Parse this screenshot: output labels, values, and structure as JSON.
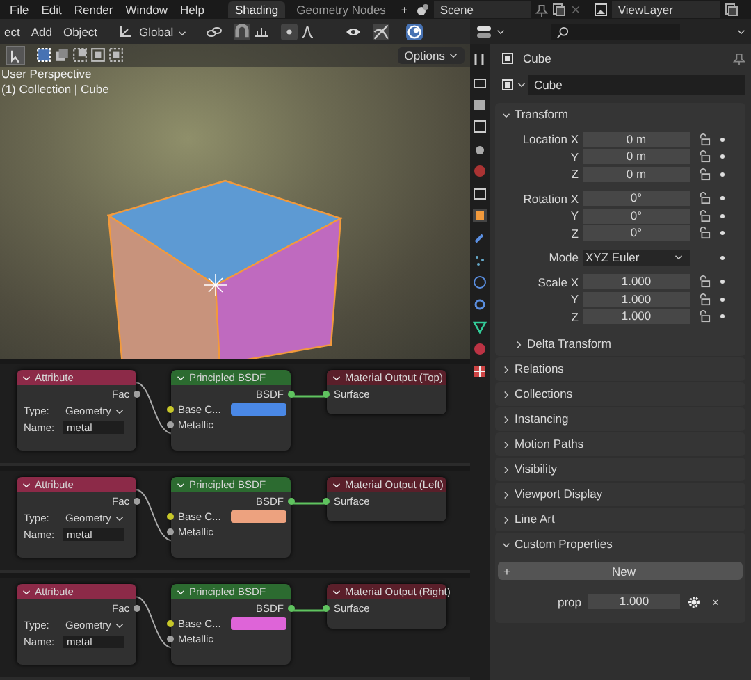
{
  "menu": [
    "File",
    "Edit",
    "Render",
    "Window",
    "Help"
  ],
  "workspace_tabs": [
    {
      "label": "Shading",
      "selected": true
    },
    {
      "label": "Geometry Nodes",
      "selected": false
    }
  ],
  "add_tab": "+",
  "scene": "Scene",
  "view_layer": "ViewLayer",
  "viewport_header": {
    "menus": [
      "ect",
      "Add",
      "Object"
    ],
    "orientation": "Global"
  },
  "viewport": {
    "options": "Options",
    "title": "User Perspective",
    "subtitle": "(1) Collection | Cube"
  },
  "node_editors": [
    {
      "attribute": {
        "title": "Attribute",
        "fac": "Fac",
        "type_label": "Type:",
        "type_value": "Geometry",
        "name_label": "Name:",
        "name_value": "metal"
      },
      "bsdf": {
        "title": "Principled BSDF",
        "output": "BSDF",
        "base_color": "Base C...",
        "metallic": "Metallic",
        "color": "#4a88e6"
      },
      "output": {
        "title": "Material Output (Top)",
        "surface": "Surface"
      }
    },
    {
      "attribute": {
        "title": "Attribute",
        "fac": "Fac",
        "type_label": "Type:",
        "type_value": "Geometry",
        "name_label": "Name:",
        "name_value": "metal"
      },
      "bsdf": {
        "title": "Principled BSDF",
        "output": "BSDF",
        "base_color": "Base C...",
        "metallic": "Metallic",
        "color": "#eda27f"
      },
      "output": {
        "title": "Material Output (Left)",
        "surface": "Surface"
      }
    },
    {
      "attribute": {
        "title": "Attribute",
        "fac": "Fac",
        "type_label": "Type:",
        "type_value": "Geometry",
        "name_label": "Name:",
        "name_value": "metal"
      },
      "bsdf": {
        "title": "Principled BSDF",
        "output": "BSDF",
        "base_color": "Base C...",
        "metallic": "Metallic",
        "color": "#de64d8"
      },
      "output": {
        "title": "Material Output (Right)",
        "surface": "Surface"
      }
    }
  ],
  "properties": {
    "object_name": "Cube",
    "datablock": "Cube",
    "transform": {
      "title": "Transform",
      "expanded": true,
      "groups": [
        [
          {
            "kind": "field",
            "label": "Location X",
            "value": "0 m"
          },
          {
            "kind": "field",
            "label": "Y",
            "value": "0 m"
          },
          {
            "kind": "field",
            "label": "Z",
            "value": "0 m"
          }
        ],
        [
          {
            "kind": "field",
            "label": "Rotation X",
            "value": "0°"
          },
          {
            "kind": "field",
            "label": "Y",
            "value": "0°"
          },
          {
            "kind": "field",
            "label": "Z",
            "value": "0°"
          }
        ],
        [
          {
            "kind": "dropdown",
            "label": "Mode",
            "value": "XYZ Euler"
          }
        ],
        [
          {
            "kind": "field",
            "label": "Scale X",
            "value": "1.000"
          },
          {
            "kind": "field",
            "label": "Y",
            "value": "1.000"
          },
          {
            "kind": "field",
            "label": "Z",
            "value": "1.000"
          }
        ]
      ],
      "subpanels": [
        {
          "label": "Delta Transform",
          "expanded": false
        }
      ]
    },
    "panels": [
      {
        "label": "Relations",
        "expanded": false
      },
      {
        "label": "Collections",
        "expanded": false
      },
      {
        "label": "Instancing",
        "expanded": false
      },
      {
        "label": "Motion Paths",
        "expanded": false
      },
      {
        "label": "Visibility",
        "expanded": false
      },
      {
        "label": "Viewport Display",
        "expanded": false
      },
      {
        "label": "Line Art",
        "expanded": false
      },
      {
        "label": "Custom Properties",
        "expanded": true
      }
    ],
    "custom": {
      "new_button": "New",
      "plus": "+",
      "prop_label": "prop",
      "prop_value": "1.000",
      "remove": "×"
    }
  }
}
